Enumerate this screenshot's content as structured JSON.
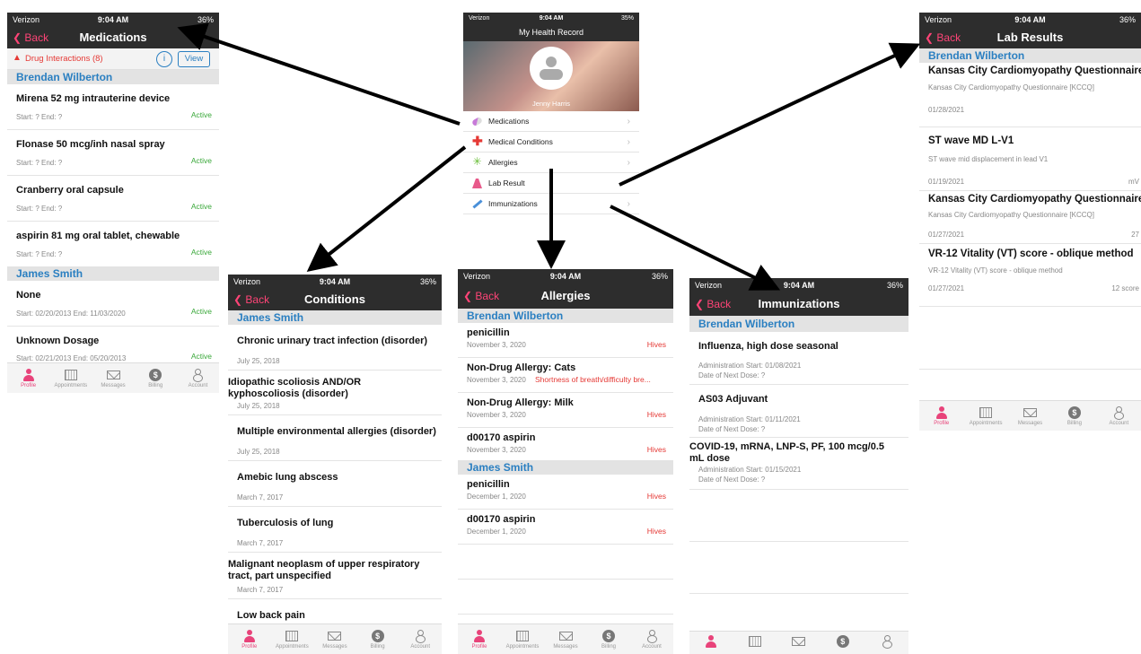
{
  "status": {
    "carrier": "Verizon",
    "time": "9:04 AM",
    "battery_36": "36%",
    "battery_35": "35%"
  },
  "tabbar": [
    {
      "label": "Profile",
      "icon": "profile-icon"
    },
    {
      "label": "Appointments",
      "icon": "calendar-icon"
    },
    {
      "label": "Messages",
      "icon": "envelope-icon"
    },
    {
      "label": "Billing",
      "icon": "dollar-icon"
    },
    {
      "label": "Account",
      "icon": "account-icon"
    }
  ],
  "back_label": "Back",
  "home": {
    "title": "My Health Record",
    "user_name": "Jenny Harris",
    "menu": [
      "Medications",
      "Medical Conditions",
      "Allergies",
      "Lab Result",
      "Immunizations"
    ],
    "chevron": "›"
  },
  "medications": {
    "title": "Medications",
    "drug_interactions": "Drug Interactions (8)",
    "info_label": "i",
    "view_label": "View",
    "groups": [
      {
        "name": "Brendan Wilberton",
        "items": [
          {
            "name": "Mirena 52 mg intrauterine device",
            "dates": "Start: ?  End: ?",
            "status": "Active"
          },
          {
            "name": "Flonase 50 mcg/inh nasal spray",
            "dates": "Start: ?  End: ?",
            "status": "Active"
          },
          {
            "name": "Cranberry oral capsule",
            "dates": "Start: ?  End: ?",
            "status": "Active"
          },
          {
            "name": "aspirin 81 mg oral tablet, chewable",
            "dates": "Start: ?  End: ?",
            "status": "Active"
          }
        ]
      },
      {
        "name": "James Smith",
        "items": [
          {
            "name": "None",
            "dates": "Start: 02/20/2013  End: 11/03/2020",
            "status": "Active"
          },
          {
            "name": "Unknown Dosage",
            "dates": "Start: 02/21/2013  End: 05/20/2013",
            "status": "Active"
          }
        ]
      }
    ]
  },
  "conditions": {
    "title": "Conditions",
    "group": "James Smith",
    "items": [
      {
        "name": "Chronic urinary tract infection (disorder)",
        "date": "July 25, 2018"
      },
      {
        "name": "Idiopathic scoliosis AND/OR kyphoscoliosis (disorder)",
        "date": "July 25, 2018"
      },
      {
        "name": "Multiple environmental allergies (disorder)",
        "date": "July 25, 2018"
      },
      {
        "name": "Amebic lung abscess",
        "date": "March 7, 2017"
      },
      {
        "name": "Tuberculosis of lung",
        "date": "March 7, 2017"
      },
      {
        "name": "Malignant neoplasm of upper respiratory tract, part unspecified",
        "date": "March 7, 2017"
      },
      {
        "name": "Low back pain",
        "date": ""
      }
    ]
  },
  "allergies": {
    "title": "Allergies",
    "groups": [
      {
        "name": "Brendan Wilberton",
        "items": [
          {
            "name": "penicillin",
            "date": "November 3, 2020",
            "reaction": "Hives"
          },
          {
            "name": "Non-Drug Allergy: Cats",
            "date": "November 3, 2020",
            "reaction": "Shortness of breath/difficulty bre..."
          },
          {
            "name": "Non-Drug Allergy: Milk",
            "date": "November 3, 2020",
            "reaction": "Hives"
          },
          {
            "name": "d00170 aspirin",
            "date": "November 3, 2020",
            "reaction": "Hives"
          }
        ]
      },
      {
        "name": "James Smith",
        "items": [
          {
            "name": "penicillin",
            "date": "December 1, 2020",
            "reaction": "Hives"
          },
          {
            "name": "d00170 aspirin",
            "date": "December 1, 2020",
            "reaction": "Hives"
          }
        ]
      }
    ]
  },
  "immunizations": {
    "title": "Immunizations",
    "group": "Brendan Wilberton",
    "items": [
      {
        "name": "Influenza, high dose seasonal",
        "start": "Administration Start:  01/08/2021",
        "next": "Date of Next Dose:  ?"
      },
      {
        "name": "AS03 Adjuvant",
        "start": "Administration Start:  01/11/2021",
        "next": "Date of Next Dose:  ?"
      },
      {
        "name": "COVID-19, mRNA, LNP-S, PF, 100 mcg/0.5 mL dose",
        "start": "Administration Start:  01/15/2021",
        "next": "Date of Next Dose:  ?"
      }
    ]
  },
  "labs": {
    "title": "Lab Results",
    "group": "Brendan Wilberton",
    "items": [
      {
        "name": "Kansas City Cardiomyopathy Questionnaire...",
        "desc": "Kansas City Cardiomyopathy Questionnaire [KCCQ]",
        "date": "01/28/2021",
        "value": ""
      },
      {
        "name": "ST wave MD L-V1",
        "desc": "ST wave mid displacement in lead V1",
        "date": "01/19/2021",
        "value": "mV"
      },
      {
        "name": "Kansas City Cardiomyopathy Questionnaire...",
        "desc": "Kansas City Cardiomyopathy Questionnaire [KCCQ]",
        "date": "01/27/2021",
        "value": "27"
      },
      {
        "name": "VR-12 Vitality (VT) score - oblique method",
        "desc": "VR-12 Vitality (VT) score - oblique method",
        "date": "01/27/2021",
        "value": "12 score"
      }
    ]
  }
}
